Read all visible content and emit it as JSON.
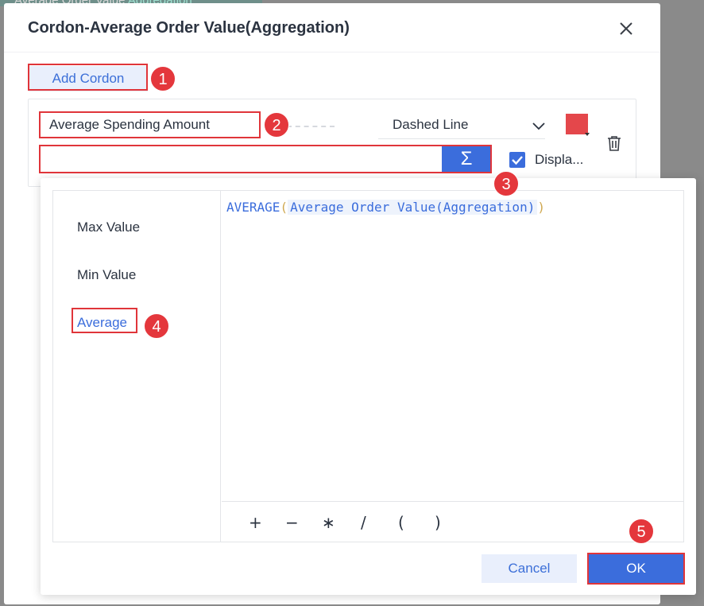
{
  "background_tab": {
    "title": "Average Order Value",
    "suffix": "Aggregation"
  },
  "dialog": {
    "title": "Cordon-Average Order Value(Aggregation)",
    "close_icon": "close-icon"
  },
  "cordon": {
    "add_label": "Add Cordon",
    "name_value": "Average Spending Amount",
    "line_style": "Dashed Line",
    "color": "#e4474b",
    "formula_value": "",
    "sigma_label": "Σ",
    "display_label": "Displa...",
    "display_checked": true
  },
  "functions": [
    "Max Value",
    "Min Value",
    "Average"
  ],
  "active_function": "Average",
  "formula": {
    "func": "AVERAGE",
    "open": "(",
    "field": "Average Order Value(Aggregation)",
    "close": ")"
  },
  "operators": [
    "+",
    "−",
    "∗",
    "/",
    "(",
    ")"
  ],
  "buttons": {
    "cancel": "Cancel",
    "ok": "OK"
  },
  "annotations": [
    "1",
    "2",
    "3",
    "4",
    "5"
  ],
  "colors": {
    "accent": "#3b6ddc",
    "annotation": "#e0353a"
  }
}
